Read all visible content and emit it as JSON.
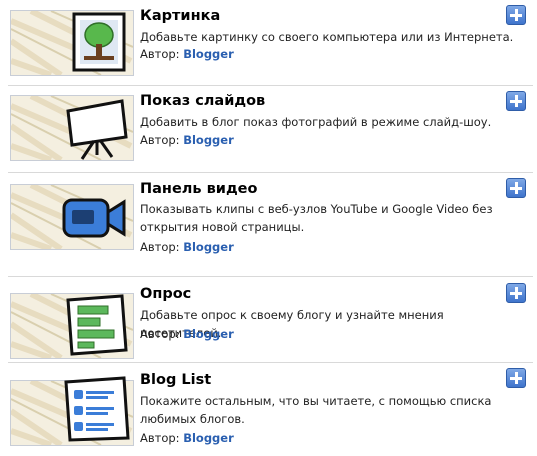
{
  "author_prefix": "Автор:",
  "gadgets": [
    {
      "title": "Картинка",
      "description": "Добавьте картинку со своего компьютера или из Интернета.",
      "author": "Blogger",
      "icon": "picture-tree-icon"
    },
    {
      "title": "Показ слайдов",
      "description": "Добавить в блог показ фотографий в режиме слайд-шоу.",
      "author": "Blogger",
      "icon": "projector-screen-icon"
    },
    {
      "title": "Панель видео",
      "description": "Показывать клипы с веб-узлов YouTube и Google Video без открытия новой страницы.",
      "author": "Blogger",
      "icon": "video-camera-icon"
    },
    {
      "title": "Опрос",
      "description": "Добавьте опрос к своему блогу и узнайте мнения посетителей.",
      "author": "Blogger",
      "icon": "poll-bars-icon"
    },
    {
      "title": "Blog List",
      "description": "Покажите остальным, что вы читаете, с помощью списка любимых блогов.",
      "author": "Blogger",
      "icon": "feed-list-icon"
    }
  ]
}
